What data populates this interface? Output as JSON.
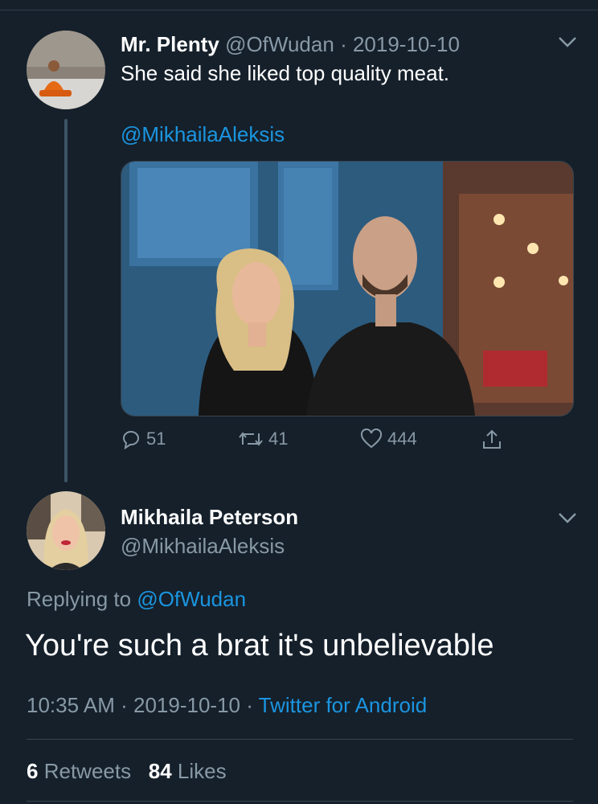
{
  "tweet1": {
    "display_name": "Mr. Plenty",
    "handle": "@OfWudan",
    "separator": "·",
    "date": "2019-10-10",
    "text": "She said she liked top quality meat.",
    "mention": "@MikhailaAleksis",
    "actions": {
      "reply_count": "51",
      "retweet_count": "41",
      "like_count": "444"
    }
  },
  "tweet2": {
    "display_name": "Mikhaila Peterson",
    "handle": "@MikhailaAleksis",
    "replying_prefix": "Replying to",
    "replying_handle": "@OfWudan",
    "text": "You're such a brat it's unbelievable",
    "time": "10:35 AM",
    "date": "2019-10-10",
    "sep": "·",
    "client": "Twitter for Android",
    "stats": {
      "retweets_count": "6",
      "retweets_label": "Retweets",
      "likes_count": "84",
      "likes_label": "Likes"
    }
  },
  "colors": {
    "background": "#15202b",
    "link": "#1b95e0",
    "muted": "#8899a6"
  }
}
